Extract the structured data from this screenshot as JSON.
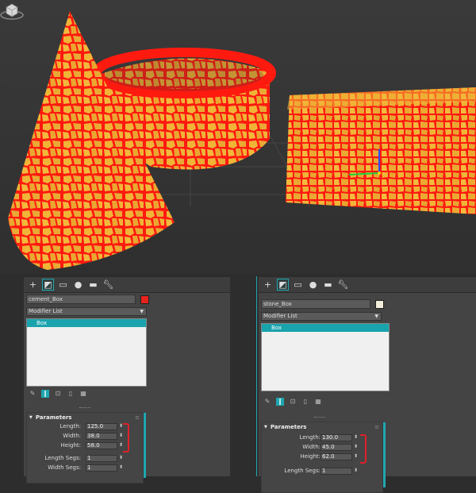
{
  "colors": {
    "accent": "#1fa7b0",
    "cement_swatch": "#e8231c",
    "stone_swatch": "#f2eedb",
    "highlight_bracket": "#e0202a",
    "mesh_fill": "#f0b437",
    "mesh_grout": "#ff1a10"
  },
  "tabs_icons": [
    "plus-icon",
    "modify-icon",
    "hierarchy-icon",
    "motion-icon",
    "display-icon",
    "utilities-icon"
  ],
  "left_panel": {
    "object_name": "cement_Box",
    "modifier_list": "Modifier List",
    "stack": [
      "Box"
    ],
    "rollout_title": "Parameters",
    "params": [
      {
        "label": "Length:",
        "value": "125.0"
      },
      {
        "label": "Width:",
        "value": "38.0"
      },
      {
        "label": "Height:",
        "value": "58.0"
      },
      {
        "label": "Length Segs:",
        "value": "1"
      },
      {
        "label": "Width Segs:",
        "value": "1"
      }
    ]
  },
  "right_panel": {
    "object_name": "stone_Box",
    "modifier_list": "Modifier List",
    "stack": [
      "Box"
    ],
    "rollout_title": "Parameters",
    "params": [
      {
        "label": "Length:",
        "value": "130.0"
      },
      {
        "label": "Width:",
        "value": "45.0"
      },
      {
        "label": "Height:",
        "value": "62.0"
      },
      {
        "label": "Length Segs:",
        "value": "1"
      }
    ]
  }
}
